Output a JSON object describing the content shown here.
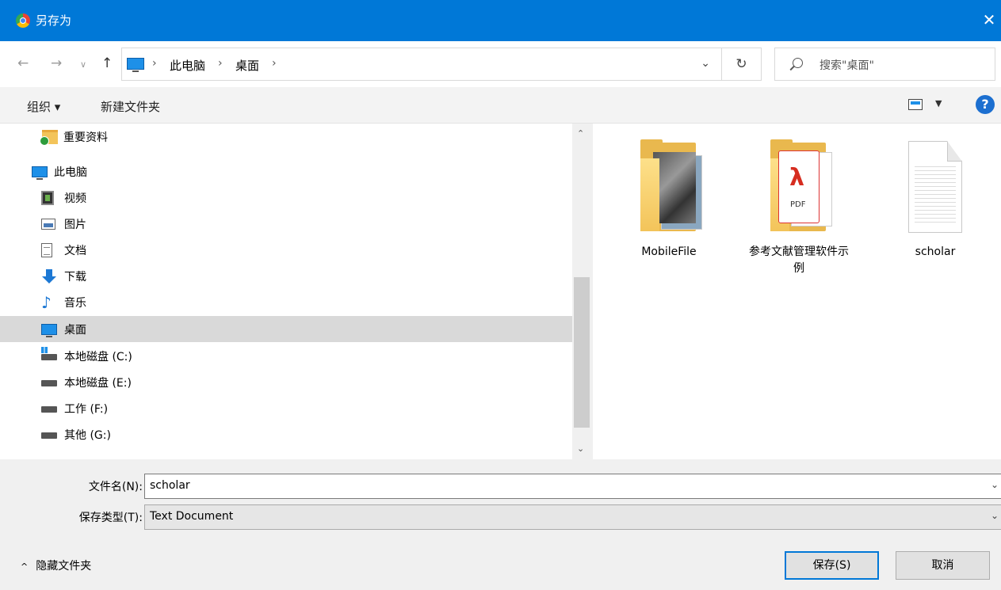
{
  "window": {
    "title": "另存为",
    "close_glyph": "✕"
  },
  "nav": {
    "back_glyph": "←",
    "forward_glyph": "→",
    "recent_glyph": "∨",
    "up_glyph": "↑",
    "breadcrumb": [
      "此电脑",
      "桌面"
    ],
    "breadcrumb_sep": "›",
    "address_dropdown_glyph": "⌄",
    "refresh_glyph": "↻",
    "search_placeholder": "搜索\"桌面\""
  },
  "toolbar": {
    "organize_label": "组织 ▾",
    "new_folder_label": "新建文件夹",
    "view_dropdown_glyph": "▼",
    "help_glyph": "?"
  },
  "sidebar": {
    "items": [
      {
        "label": "重要资料",
        "icon": "folder-check-icon"
      },
      {
        "label": "此电脑",
        "icon": "computer-icon"
      },
      {
        "label": "视频",
        "icon": "video-icon"
      },
      {
        "label": "图片",
        "icon": "picture-icon"
      },
      {
        "label": "文档",
        "icon": "document-icon"
      },
      {
        "label": "下载",
        "icon": "download-icon"
      },
      {
        "label": "音乐",
        "icon": "music-icon"
      },
      {
        "label": "桌面",
        "icon": "desktop-icon",
        "selected": true
      },
      {
        "label": "本地磁盘 (C:)",
        "icon": "system-drive-icon"
      },
      {
        "label": "本地磁盘 (E:)",
        "icon": "drive-icon"
      },
      {
        "label": "工作 (F:)",
        "icon": "drive-icon"
      },
      {
        "label": "其他 (G:)",
        "icon": "drive-icon"
      }
    ],
    "scroll_up_glyph": "⌃",
    "scroll_down_glyph": "⌄",
    "music_glyph": "♪"
  },
  "files": [
    {
      "name": "MobileFile",
      "type": "folder-photos"
    },
    {
      "name": "参考文献管理软件示例",
      "type": "folder-pdf",
      "pdf_text": "PDF"
    },
    {
      "name": "scholar",
      "type": "text-document"
    }
  ],
  "form": {
    "filename_label": "文件名(N):",
    "filename_value": "scholar",
    "filetype_label": "保存类型(T):",
    "filetype_value": "Text Document",
    "dropdown_glyph": "⌄"
  },
  "footer": {
    "hide_folders_label": "隐藏文件夹",
    "hide_folders_chevron": "^",
    "save_label": "保存(S)",
    "cancel_label": "取消"
  },
  "colors": {
    "title_bar": "#0078d7",
    "selection": "#d9d9d9",
    "save_border": "#0078d7"
  }
}
